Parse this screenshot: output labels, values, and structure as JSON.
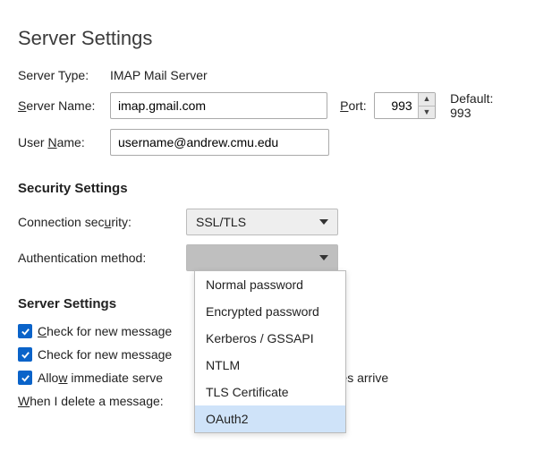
{
  "heading": "Server Settings",
  "server_type_label": "Server Type:",
  "server_type_value": "IMAP Mail Server",
  "server_name_label_pre": "",
  "server_name_label_u": "S",
  "server_name_label_post": "erver Name:",
  "server_name_value": "imap.gmail.com",
  "port_label_pre": "",
  "port_label_u": "P",
  "port_label_post": "ort:",
  "port_value": "993",
  "default_port_text": "Default: 993",
  "user_name_label_pre": "User ",
  "user_name_label_u": "N",
  "user_name_label_post": "ame:",
  "user_name_value": "username@andrew.cmu.edu",
  "security_heading": "Security Settings",
  "conn_sec_label_pre": "Connection sec",
  "conn_sec_label_u": "u",
  "conn_sec_label_post": "rity:",
  "conn_sec_value": "SSL/TLS",
  "auth_label": "Authentication method:",
  "auth_options": [
    "Normal password",
    "Encrypted password",
    "Kerberos / GSSAPI",
    "NTLM",
    "TLS Certificate",
    "OAuth2"
  ],
  "auth_highlighted": "OAuth2",
  "server_settings_heading": "Server Settings",
  "check1_pre": "",
  "check1_u": "C",
  "check1_post": "heck for new message",
  "check2": "Check for new message",
  "check3_pre": "Allo",
  "check3_u": "w",
  "check3_post": " immediate serve",
  "check3_tail": "essages arrive",
  "delete_pre": "",
  "delete_u": "W",
  "delete_post": "hen I delete a message:"
}
